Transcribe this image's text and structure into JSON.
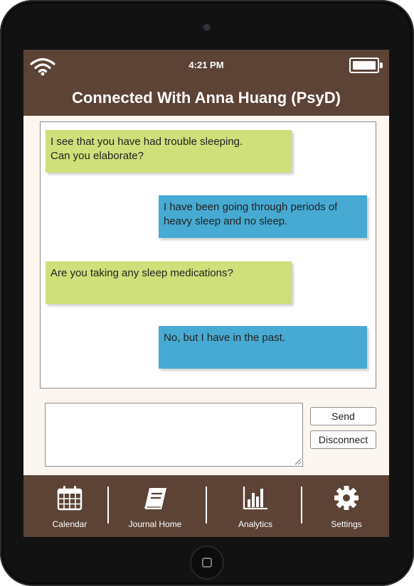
{
  "status_bar": {
    "time": "4:21 PM",
    "wifi_icon": "wifi-icon",
    "battery_icon": "battery-icon"
  },
  "header": {
    "title": "Connected With Anna Huang (PsyD)"
  },
  "messages": [
    {
      "sender": "therapist",
      "text": "I see that you have had trouble sleeping.\nCan you elaborate?",
      "color": "#cfdf7a"
    },
    {
      "sender": "user",
      "text": "I have been going through periods of heavy sleep and no sleep.",
      "color": "#47aad3"
    },
    {
      "sender": "therapist",
      "text": "Are you taking any sleep medications?",
      "color": "#cfdf7a"
    },
    {
      "sender": "user",
      "text": "No, but I have in the past.",
      "color": "#47aad3"
    }
  ],
  "composer": {
    "input_value": "",
    "send_label": "Send",
    "disconnect_label": "Disconnect"
  },
  "nav": {
    "items": [
      {
        "label": "Calendar",
        "icon": "calendar-icon"
      },
      {
        "label": "Journal Home",
        "icon": "journal-icon"
      },
      {
        "label": "Analytics",
        "icon": "analytics-icon"
      },
      {
        "label": "Settings",
        "icon": "gear-icon"
      }
    ]
  },
  "colors": {
    "brand_brown": "#5c4336",
    "therapist_bubble": "#cfdf7a",
    "user_bubble": "#47aad3",
    "screen_background": "#fcf6f1"
  }
}
